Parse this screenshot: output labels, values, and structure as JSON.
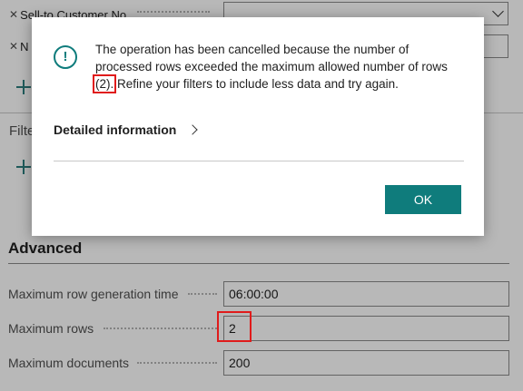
{
  "background": {
    "filters": [
      {
        "label": "Sell-to Customer No."
      },
      {
        "label": "N"
      }
    ],
    "filter_heading": "Filte",
    "advanced": {
      "heading": "Advanced",
      "fields": [
        {
          "label": "Maximum row generation time",
          "value": "06:00:00"
        },
        {
          "label": "Maximum rows",
          "value": "2"
        },
        {
          "label": "Maximum documents",
          "value": "200"
        }
      ]
    }
  },
  "dialog": {
    "message_before": "The operation has been cancelled because the number of processed rows exceeded the maximum allowed number of rows ",
    "message_highlight": "(2).",
    "message_after": " Refine your filters to include less data and try again.",
    "details_label": "Detailed information",
    "ok_label": "OK"
  },
  "colors": {
    "accent": "#0f7c7c",
    "annotation": "#e01b1b"
  },
  "icons": {
    "alert": "exclamation-circle-icon",
    "chevron": "chevron-right-icon",
    "close": "close-icon",
    "add": "plus-icon"
  }
}
